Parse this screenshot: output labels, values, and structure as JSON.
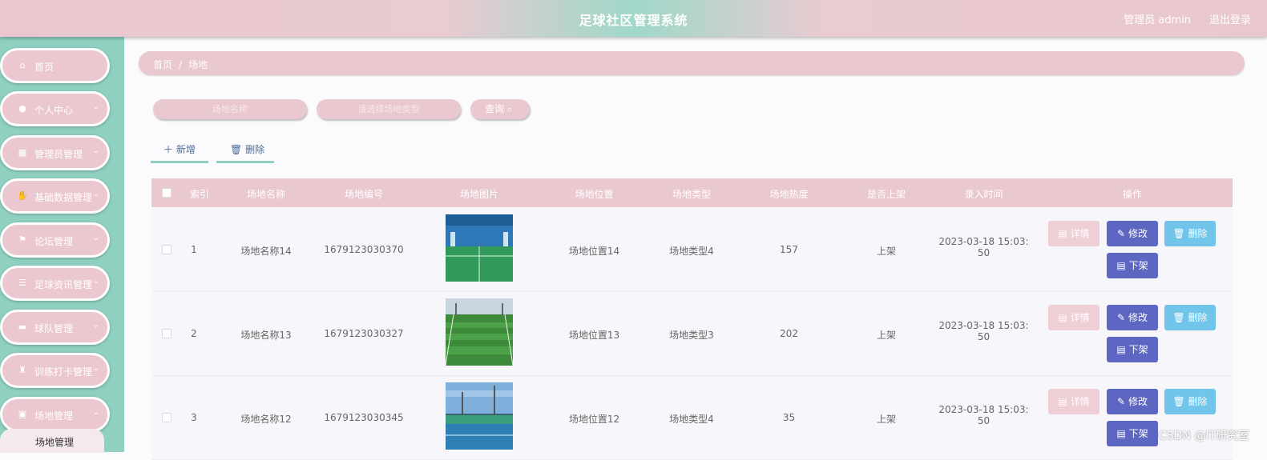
{
  "header": {
    "title": "足球社区管理系统",
    "admin": "管理员 admin",
    "logout": "退出登录"
  },
  "sidebar": {
    "items": [
      {
        "label": "首页",
        "icon": "home-icon",
        "has_children": false
      },
      {
        "label": "个人中心",
        "icon": "user-icon",
        "has_children": true
      },
      {
        "label": "管理员管理",
        "icon": "table-icon",
        "has_children": true
      },
      {
        "label": "基础数据管理",
        "icon": "hand-icon",
        "has_children": true
      },
      {
        "label": "论坛管理",
        "icon": "flag-icon",
        "has_children": true
      },
      {
        "label": "足球资讯管理",
        "icon": "sliders-icon",
        "has_children": true
      },
      {
        "label": "球队管理",
        "icon": "briefcase-icon",
        "has_children": true
      },
      {
        "label": "训练打卡管理",
        "icon": "cup-icon",
        "has_children": true
      },
      {
        "label": "场地管理",
        "icon": "bag-icon",
        "has_children": true
      }
    ],
    "submenu": "场地管理"
  },
  "breadcrumb": {
    "home": "首页",
    "sep": "/",
    "current": "场地"
  },
  "search": {
    "name_placeholder": "场地名称",
    "type_placeholder": "请选择场地类型",
    "query": "查询"
  },
  "actions": {
    "add": "新增",
    "delete": "删除"
  },
  "table": {
    "headers": [
      "索引",
      "场地名称",
      "场地编号",
      "场地图片",
      "场地位置",
      "场地类型",
      "场地热度",
      "是否上架",
      "录入时间",
      "操作"
    ],
    "rows": [
      {
        "index": "1",
        "name": "场地名称14",
        "code": "1679123030370",
        "location": "场地位置14",
        "type": "场地类型4",
        "heat": "157",
        "status": "上架",
        "time1": "2023-03-18 15:03:",
        "time2": "50"
      },
      {
        "index": "2",
        "name": "场地名称13",
        "code": "1679123030327",
        "location": "场地位置13",
        "type": "场地类型3",
        "heat": "202",
        "status": "上架",
        "time1": "2023-03-18 15:03:",
        "time2": "50"
      },
      {
        "index": "3",
        "name": "场地名称12",
        "code": "1679123030345",
        "location": "场地位置12",
        "type": "场地类型4",
        "heat": "35",
        "status": "上架",
        "time1": "2023-03-18 15:03:",
        "time2": "50"
      }
    ],
    "ops": {
      "detail": "详情",
      "edit": "修改",
      "delete": "删除",
      "off": "下架"
    }
  },
  "watermark": "CSDN @IT研究室",
  "colors": {
    "pink": "#eac8d0",
    "teal": "#8fd0c1",
    "edit": "#5d67c2",
    "delete": "#71c4ea"
  }
}
